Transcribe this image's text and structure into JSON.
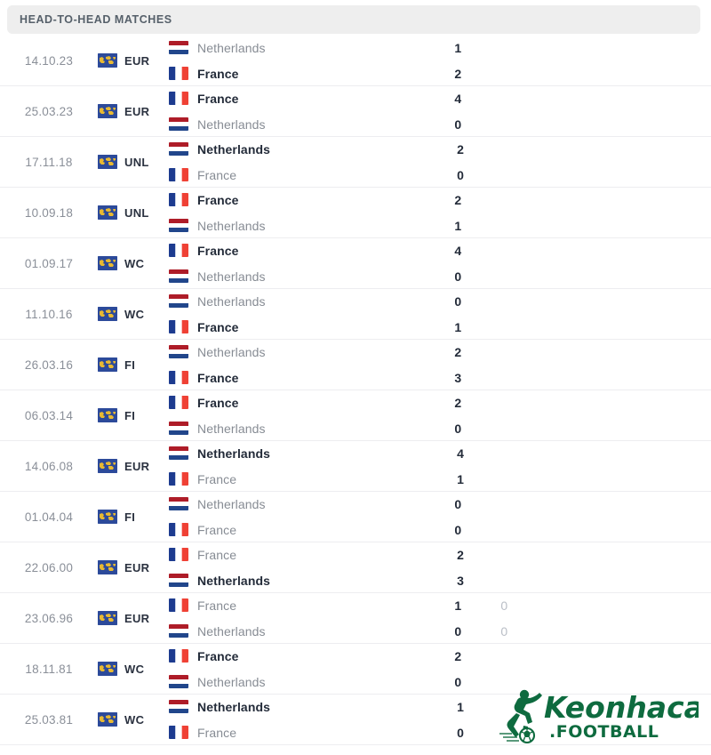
{
  "header": {
    "title": "HEAD-TO-HEAD MATCHES"
  },
  "logo": {
    "name": "Keonhacai",
    "suffix": ".FOOTBALL",
    "color": "#0e6b3f"
  },
  "colors": {
    "header_bg": "#eeeeee",
    "header_text": "#56606a",
    "date_text": "#8a8f98",
    "team_muted": "#878c94",
    "team_winner": "#232b39",
    "score": "#232b39",
    "score_alt": "#b9bec6",
    "row_border": "#ededf0",
    "comp_icon_bg": "#2c4a9a",
    "comp_icon_map": "#e8b931",
    "flag_nl_red": "#ae1c28",
    "flag_nl_white": "#ffffff",
    "flag_nl_blue": "#21468b",
    "flag_fr_blue": "#1d3b8f",
    "flag_fr_white": "#ffffff",
    "flag_fr_red": "#ef4135"
  },
  "matches": [
    {
      "date": "14.10.23",
      "competition": "EUR",
      "competition_icon": "world-map-icon",
      "home": {
        "team": "Netherlands",
        "flag": "netherlands-flag",
        "score": "1",
        "alt_score": "",
        "winner": false
      },
      "away": {
        "team": "France",
        "flag": "france-flag",
        "score": "2",
        "alt_score": "",
        "winner": true
      }
    },
    {
      "date": "25.03.23",
      "competition": "EUR",
      "competition_icon": "world-map-icon",
      "home": {
        "team": "France",
        "flag": "france-flag",
        "score": "4",
        "alt_score": "",
        "winner": true
      },
      "away": {
        "team": "Netherlands",
        "flag": "netherlands-flag",
        "score": "0",
        "alt_score": "",
        "winner": false
      }
    },
    {
      "date": "17.11.18",
      "competition": "UNL",
      "competition_icon": "world-map-icon",
      "home": {
        "team": "Netherlands",
        "flag": "netherlands-flag",
        "score": "2",
        "alt_score": "",
        "winner": true
      },
      "away": {
        "team": "France",
        "flag": "france-flag",
        "score": "0",
        "alt_score": "",
        "winner": false
      }
    },
    {
      "date": "10.09.18",
      "competition": "UNL",
      "competition_icon": "world-map-icon",
      "home": {
        "team": "France",
        "flag": "france-flag",
        "score": "2",
        "alt_score": "",
        "winner": true
      },
      "away": {
        "team": "Netherlands",
        "flag": "netherlands-flag",
        "score": "1",
        "alt_score": "",
        "winner": false
      }
    },
    {
      "date": "01.09.17",
      "competition": "WC",
      "competition_icon": "world-map-icon",
      "home": {
        "team": "France",
        "flag": "france-flag",
        "score": "4",
        "alt_score": "",
        "winner": true
      },
      "away": {
        "team": "Netherlands",
        "flag": "netherlands-flag",
        "score": "0",
        "alt_score": "",
        "winner": false
      }
    },
    {
      "date": "11.10.16",
      "competition": "WC",
      "competition_icon": "world-map-icon",
      "home": {
        "team": "Netherlands",
        "flag": "netherlands-flag",
        "score": "0",
        "alt_score": "",
        "winner": false
      },
      "away": {
        "team": "France",
        "flag": "france-flag",
        "score": "1",
        "alt_score": "",
        "winner": true
      }
    },
    {
      "date": "26.03.16",
      "competition": "FI",
      "competition_icon": "world-map-icon",
      "home": {
        "team": "Netherlands",
        "flag": "netherlands-flag",
        "score": "2",
        "alt_score": "",
        "winner": false
      },
      "away": {
        "team": "France",
        "flag": "france-flag",
        "score": "3",
        "alt_score": "",
        "winner": true
      }
    },
    {
      "date": "06.03.14",
      "competition": "FI",
      "competition_icon": "world-map-icon",
      "home": {
        "team": "France",
        "flag": "france-flag",
        "score": "2",
        "alt_score": "",
        "winner": true
      },
      "away": {
        "team": "Netherlands",
        "flag": "netherlands-flag",
        "score": "0",
        "alt_score": "",
        "winner": false
      }
    },
    {
      "date": "14.06.08",
      "competition": "EUR",
      "competition_icon": "world-map-icon",
      "home": {
        "team": "Netherlands",
        "flag": "netherlands-flag",
        "score": "4",
        "alt_score": "",
        "winner": true
      },
      "away": {
        "team": "France",
        "flag": "france-flag",
        "score": "1",
        "alt_score": "",
        "winner": false
      }
    },
    {
      "date": "01.04.04",
      "competition": "FI",
      "competition_icon": "world-map-icon",
      "home": {
        "team": "Netherlands",
        "flag": "netherlands-flag",
        "score": "0",
        "alt_score": "",
        "winner": false
      },
      "away": {
        "team": "France",
        "flag": "france-flag",
        "score": "0",
        "alt_score": "",
        "winner": false
      }
    },
    {
      "date": "22.06.00",
      "competition": "EUR",
      "competition_icon": "world-map-icon",
      "home": {
        "team": "France",
        "flag": "france-flag",
        "score": "2",
        "alt_score": "",
        "winner": false
      },
      "away": {
        "team": "Netherlands",
        "flag": "netherlands-flag",
        "score": "3",
        "alt_score": "",
        "winner": true
      }
    },
    {
      "date": "23.06.96",
      "competition": "EUR",
      "competition_icon": "world-map-icon",
      "home": {
        "team": "France",
        "flag": "france-flag",
        "score": "1",
        "alt_score": "0",
        "winner": false
      },
      "away": {
        "team": "Netherlands",
        "flag": "netherlands-flag",
        "score": "0",
        "alt_score": "0",
        "winner": false
      }
    },
    {
      "date": "18.11.81",
      "competition": "WC",
      "competition_icon": "world-map-icon",
      "home": {
        "team": "France",
        "flag": "france-flag",
        "score": "2",
        "alt_score": "",
        "winner": true
      },
      "away": {
        "team": "Netherlands",
        "flag": "netherlands-flag",
        "score": "0",
        "alt_score": "",
        "winner": false
      }
    },
    {
      "date": "25.03.81",
      "competition": "WC",
      "competition_icon": "world-map-icon",
      "home": {
        "team": "Netherlands",
        "flag": "netherlands-flag",
        "score": "1",
        "alt_score": "",
        "winner": true
      },
      "away": {
        "team": "France",
        "flag": "france-flag",
        "score": "0",
        "alt_score": "",
        "winner": false
      }
    }
  ]
}
